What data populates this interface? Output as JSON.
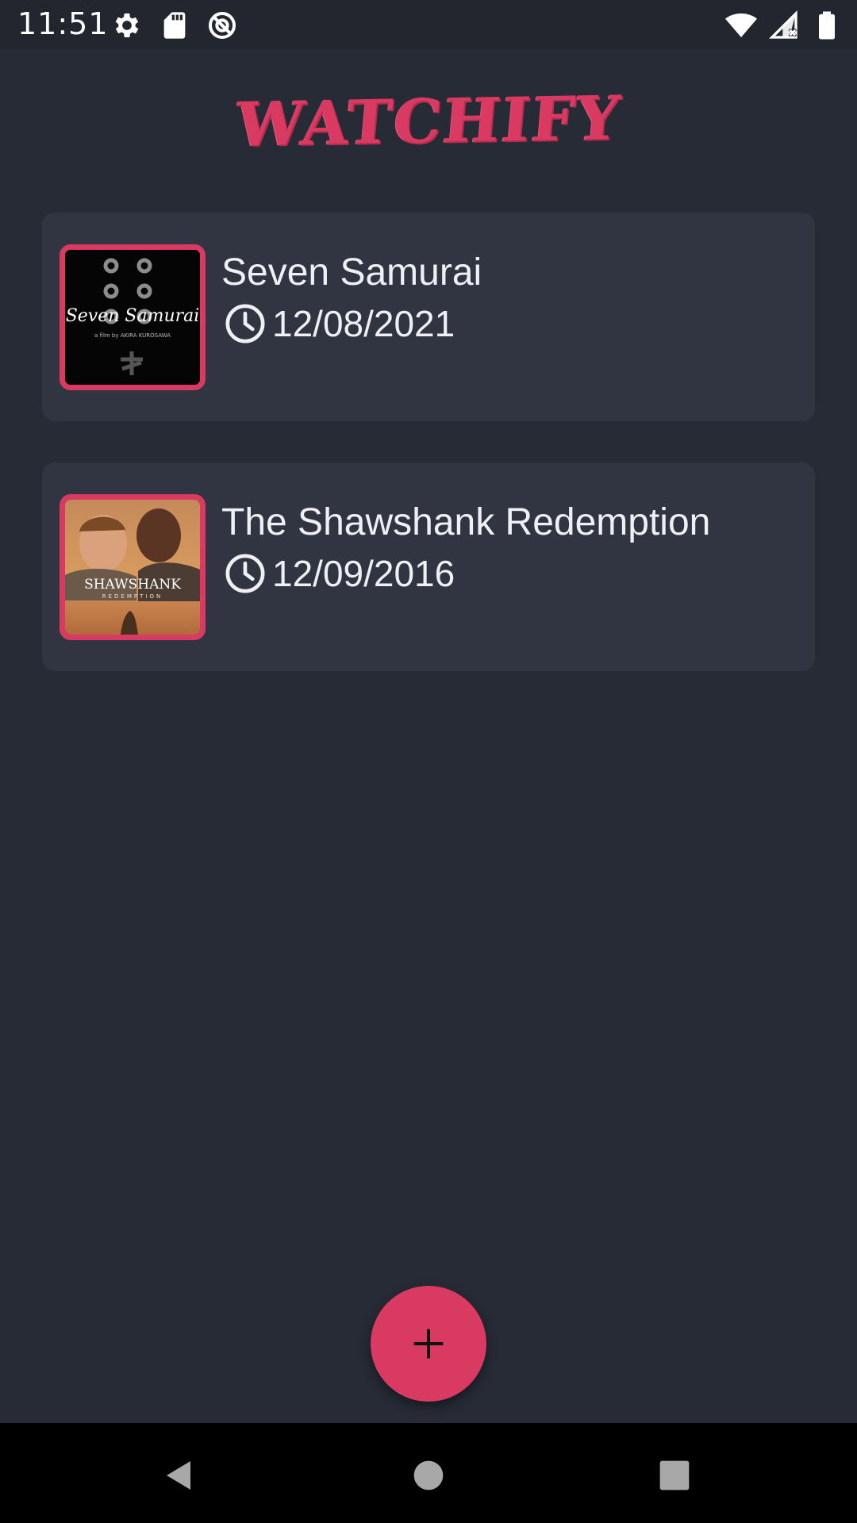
{
  "status_bar": {
    "time": "11:51",
    "left_icons": [
      "gear-icon",
      "sd-card-icon",
      "no-data-icon"
    ],
    "right_icons": [
      "wifi-icon",
      "signal-icon",
      "battery-icon"
    ]
  },
  "header": {
    "logo": "WATCHIFY"
  },
  "movies": [
    {
      "title": "Seven Samurai",
      "date": "12/08/2021",
      "poster": {
        "lettering": "Seven Samurai",
        "lettering_sub": "a film by AKIRA KUROSAWA"
      }
    },
    {
      "title": "The Shawshank Redemption",
      "date": "12/09/2016",
      "poster": {
        "lettering": "SHAWSHANK",
        "lettering_sub": "REDEMPTION"
      }
    }
  ],
  "fab": {
    "icon": "plus-icon"
  },
  "nav_bar": {
    "icons": [
      "back-icon",
      "home-icon",
      "recents-icon"
    ]
  },
  "colors": {
    "accent": "#d93a62",
    "background": "#272b36",
    "card": "#313542",
    "text": "#eef0f4"
  }
}
